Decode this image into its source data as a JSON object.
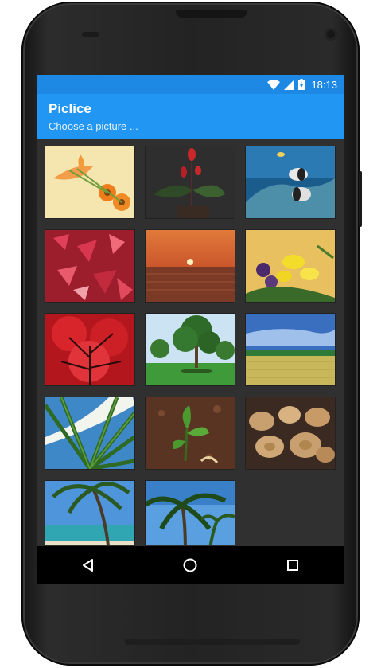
{
  "status_bar": {
    "time": "18:13",
    "icons": [
      "wifi-icon",
      "cell-signal-icon",
      "battery-charging-icon"
    ]
  },
  "app_bar": {
    "title": "Piclice",
    "subtitle": "Choose a picture ..."
  },
  "gallery": {
    "pictures": [
      {
        "subject": "orange gerbera flowers"
      },
      {
        "subject": "red flowers on dark background"
      },
      {
        "subject": "tropical fish underwater"
      },
      {
        "subject": "red autumn leaves"
      },
      {
        "subject": "sunset over sea"
      },
      {
        "subject": "yellow lilies bouquet"
      },
      {
        "subject": "red maple tree"
      },
      {
        "subject": "green trees in park"
      },
      {
        "subject": "wheat field under blue sky"
      },
      {
        "subject": "palm leaf against sky"
      },
      {
        "subject": "seedling in soil"
      },
      {
        "subject": "cut wood logs"
      },
      {
        "subject": "palm tree on beach"
      },
      {
        "subject": "palm trees against sky"
      }
    ]
  },
  "nav_bar": {
    "buttons": [
      "back-icon",
      "home-icon",
      "recent-apps-icon"
    ]
  },
  "colors": {
    "status_bar": "#1e88e5",
    "app_bar": "#2196f3",
    "screen_bg": "#303030",
    "nav_bar": "#000000"
  }
}
